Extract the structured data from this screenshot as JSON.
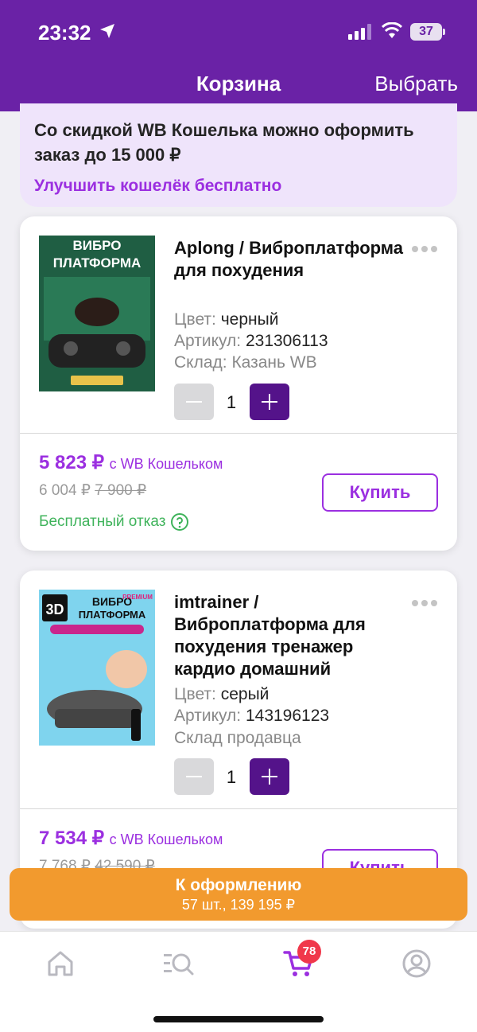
{
  "status_bar": {
    "time": "23:32",
    "battery": "37"
  },
  "nav": {
    "title": "Корзина",
    "action": "Выбрать"
  },
  "promo": {
    "text": "Со скидкой WB Кошелька можно оформить заказ до 15 000 ₽",
    "link": "Улучшить кошелёк бесплатно"
  },
  "items": [
    {
      "title": "Aplong / Виброплатформа для похудения",
      "color_label": "Цвет:",
      "color": "черный",
      "article_label": "Артикул:",
      "article": "231306113",
      "warehouse_label": "Склад:",
      "warehouse": "Казань WB",
      "quantity": "1",
      "price": "5 823 ₽",
      "price_suffix": "с WB Кошельком",
      "old_price": "6 004 ₽",
      "original_price": "7 900 ₽",
      "buy_label": "Купить",
      "free_return": "Бесплатный отказ",
      "image": {
        "line1": "ВИБРО",
        "line2": "ПЛАТФОРМА"
      }
    },
    {
      "title": "imtrainer / Виброплатформа для похудения тренажер кардио домашний",
      "color_label": "Цвет:",
      "color": "серый",
      "article_label": "Артикул:",
      "article": "143196123",
      "warehouse": "Склад продавца",
      "quantity": "1",
      "price": "7 534 ₽",
      "price_suffix": "с WB Кошельком",
      "old_price": "7 768 ₽",
      "original_price": "42 590 ₽",
      "buy_label": "Купить",
      "image": {
        "line1": "ВИБРО",
        "line2": "ПЛАТФОРМА",
        "badge": "3D",
        "tag": "PREMIUM"
      }
    }
  ],
  "checkout": {
    "title": "К оформлению",
    "summary": "57 шт., 139 195 ₽"
  },
  "tabbar": {
    "cart_badge": "78"
  },
  "colors": {
    "brand": "#6a22a6",
    "accent": "#9b2fe0",
    "checkout": "#f29a2e",
    "success": "#3fb35b"
  }
}
